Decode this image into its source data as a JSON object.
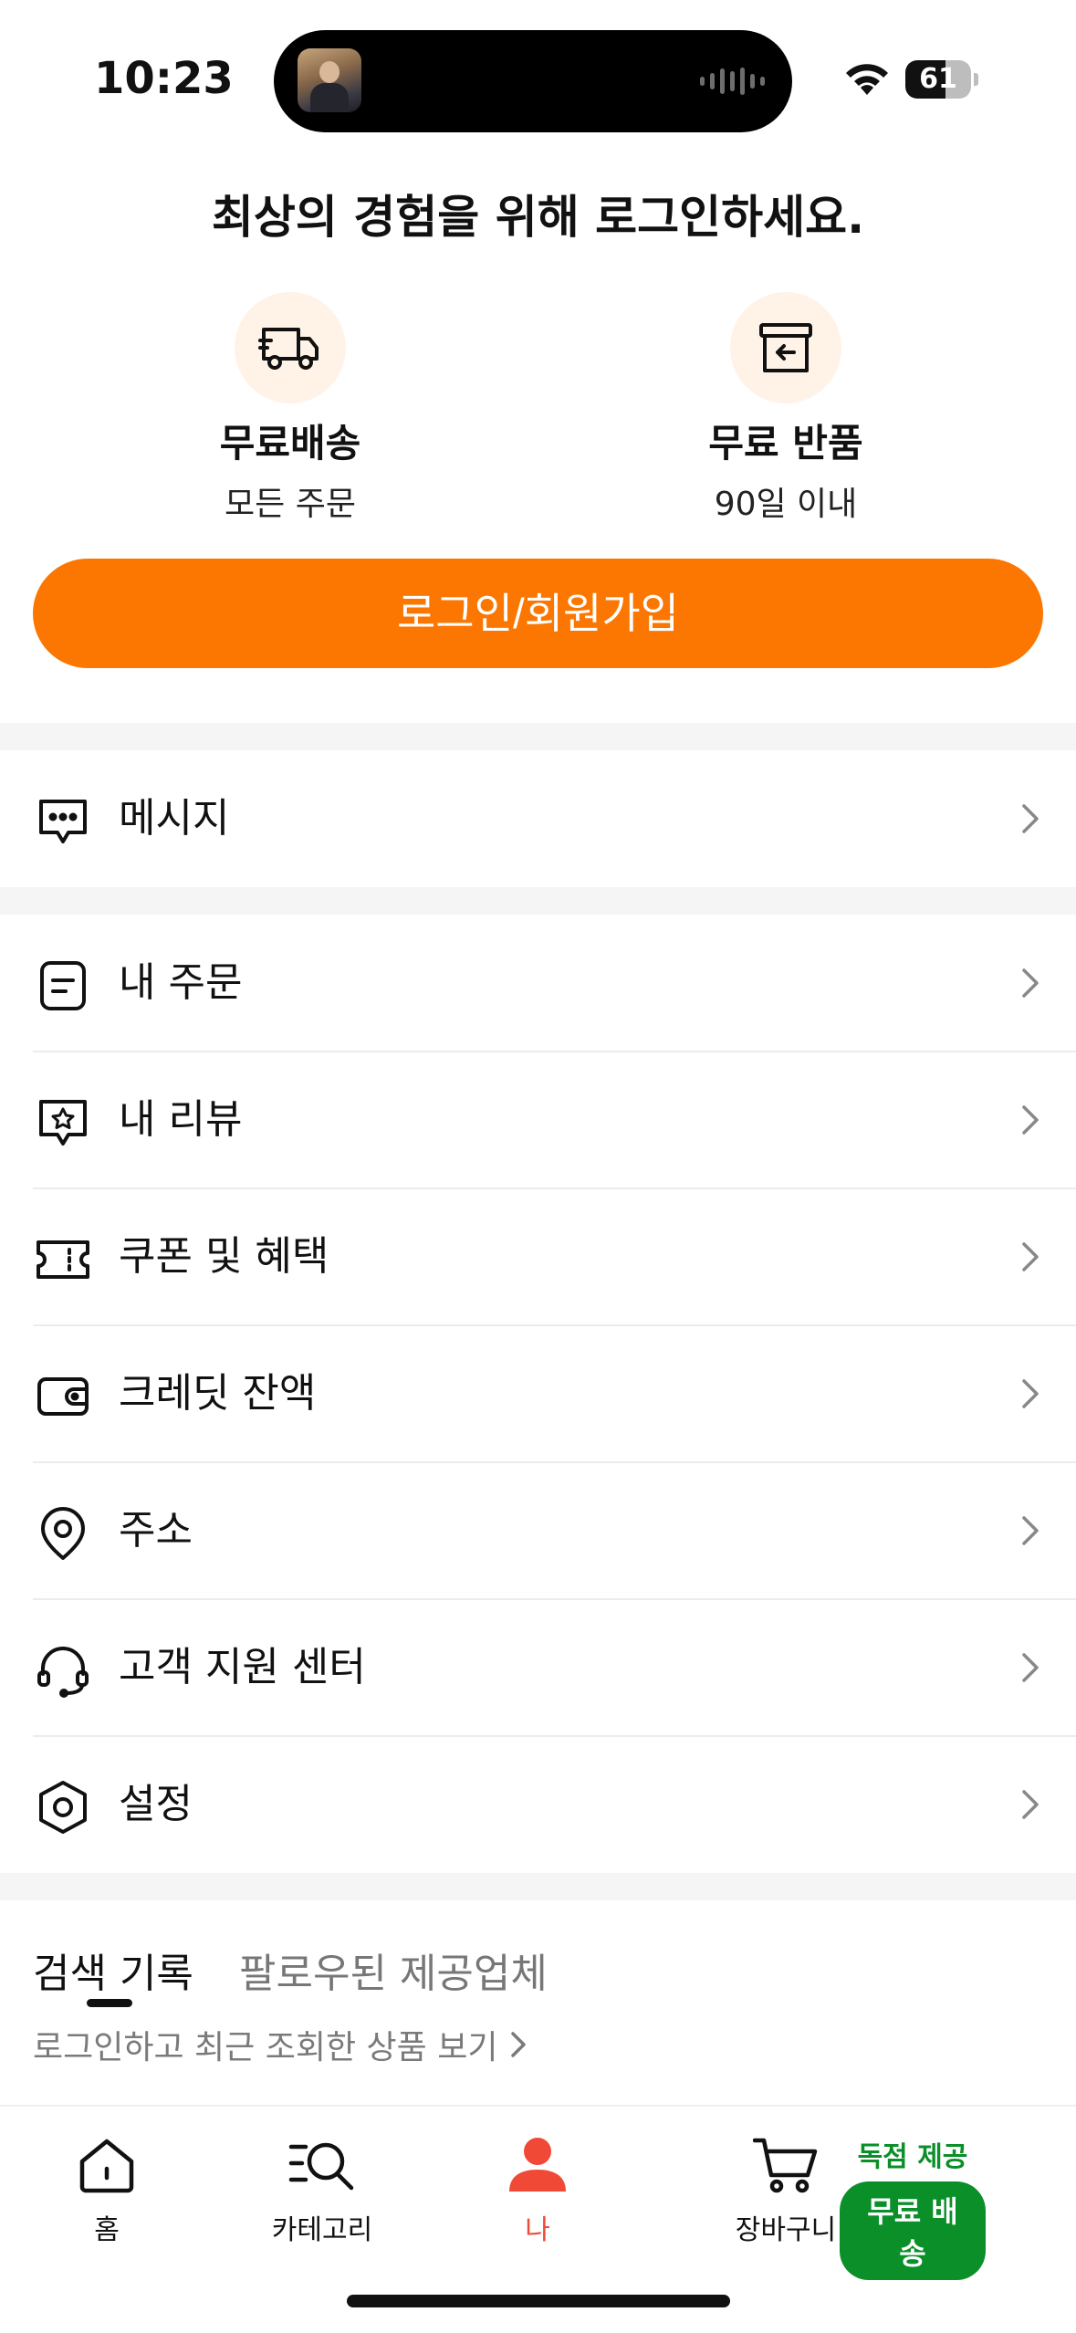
{
  "status_bar": {
    "time": "10:23",
    "battery": "61",
    "battery_fraction": 0.61
  },
  "promo": {
    "title": "최상의 경험을 위해 로그인하세요.",
    "benefits": [
      {
        "icon": "truck-icon",
        "title": "무료배송",
        "subtitle": "모든 주문"
      },
      {
        "icon": "return-box-icon",
        "title": "무료 반품",
        "subtitle": "90일 이내"
      }
    ],
    "login_button": "로그인/회원가입",
    "accent_color": "#fb7701"
  },
  "menu": {
    "messages": {
      "icon": "chat-bubble-icon",
      "label": "메시지"
    },
    "items": [
      {
        "icon": "order-list-icon",
        "label": "내 주문"
      },
      {
        "icon": "review-star-icon",
        "label": "내 리뷰"
      },
      {
        "icon": "coupon-icon",
        "label": "쿠폰 및 혜택"
      },
      {
        "icon": "wallet-icon",
        "label": "크레딧 잔액"
      },
      {
        "icon": "location-pin-icon",
        "label": "주소"
      },
      {
        "icon": "headset-icon",
        "label": "고객 지원 센터"
      },
      {
        "icon": "settings-hexagon-icon",
        "label": "설정"
      }
    ]
  },
  "tabs": {
    "active": "검색 기록",
    "inactive": "팔로우된 제공업체",
    "hint": "로그인하고 최근 조회한 상품 보기"
  },
  "bottom_nav": {
    "items": [
      {
        "icon": "home-icon",
        "label": "홈"
      },
      {
        "icon": "category-search-icon",
        "label": "카테고리"
      },
      {
        "icon": "person-icon",
        "label": "나"
      },
      {
        "icon": "cart-icon",
        "label": "장바구니"
      }
    ],
    "promo_top": "독점 제공",
    "promo_badge": "무료 배송",
    "active_color": "#f04a37",
    "promo_color": "#0a8f29"
  }
}
